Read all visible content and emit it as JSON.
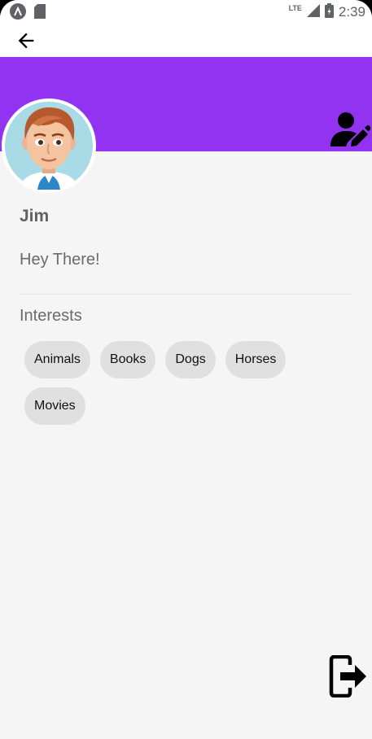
{
  "status_bar": {
    "network": "LTE",
    "time": "2:39"
  },
  "profile": {
    "name": "Jim",
    "status": "Hey There!"
  },
  "interests": {
    "title": "Interests",
    "items": [
      "Animals",
      "Books",
      "Dogs",
      "Horses",
      "Movies"
    ]
  },
  "icons": {
    "back": "arrow-back-icon",
    "edit_profile": "person-edit-icon",
    "logout": "logout-icon"
  },
  "colors": {
    "accent": "#9333f2",
    "background": "#f5f5f5",
    "chip": "#e0e0e0"
  }
}
